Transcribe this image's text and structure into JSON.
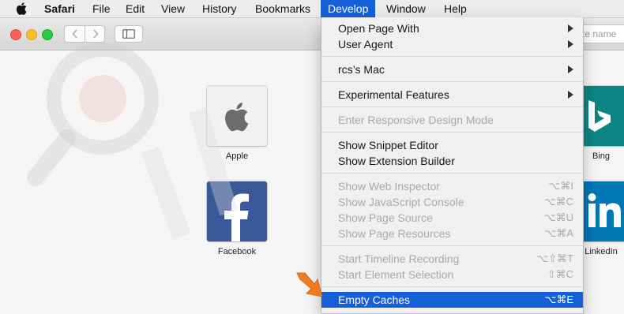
{
  "menubar": {
    "app_name": "Safari",
    "items": [
      "File",
      "Edit",
      "View",
      "History",
      "Bookmarks",
      "Develop",
      "Window",
      "Help"
    ]
  },
  "toolbar": {
    "search_placeholder": "te name"
  },
  "favorites": [
    {
      "label": "Apple"
    },
    {
      "label": "Facebook"
    },
    {
      "label": "Bing"
    },
    {
      "label": "LinkedIn"
    }
  ],
  "develop_menu": {
    "groups": [
      [
        {
          "label": "Open Page With",
          "submenu": true
        },
        {
          "label": "User Agent",
          "submenu": true
        }
      ],
      [
        {
          "label": "rcs’s Mac",
          "submenu": true
        }
      ],
      [
        {
          "label": "Experimental Features",
          "submenu": true
        }
      ],
      [
        {
          "label": "Enter Responsive Design Mode",
          "disabled": true
        }
      ],
      [
        {
          "label": "Show Snippet Editor"
        },
        {
          "label": "Show Extension Builder"
        }
      ],
      [
        {
          "label": "Show Web Inspector",
          "shortcut": "⌥⌘I",
          "disabled": true
        },
        {
          "label": "Show JavaScript Console",
          "shortcut": "⌥⌘C",
          "disabled": true
        },
        {
          "label": "Show Page Source",
          "shortcut": "⌥⌘U",
          "disabled": true
        },
        {
          "label": "Show Page Resources",
          "shortcut": "⌥⌘A",
          "disabled": true
        }
      ],
      [
        {
          "label": "Start Timeline Recording",
          "shortcut": "⌥⇧⌘T",
          "disabled": true
        },
        {
          "label": "Start Element Selection",
          "shortcut": "⇧⌘C",
          "disabled": true
        }
      ],
      [
        {
          "label": "Empty Caches",
          "shortcut": "⌥⌘E",
          "highlighted": true
        }
      ]
    ]
  },
  "colors": {
    "menu_highlight": "#1560d8",
    "arrow": "#f07c22"
  }
}
